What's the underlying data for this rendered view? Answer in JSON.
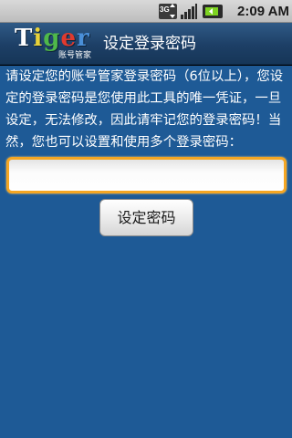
{
  "status_bar": {
    "network_label": "3G",
    "time": "2:09 AM",
    "icons": [
      "3g-data-icon",
      "signal-icon",
      "battery-icon"
    ]
  },
  "app_bar": {
    "logo_letters": [
      "T",
      "i",
      "g",
      "e",
      "r"
    ],
    "logo_colors": [
      "#ffffff",
      "#e8d23a",
      "#4fb84a",
      "#e03a2e",
      "#4a8fd8"
    ],
    "logo_subtitle": "账号管家",
    "title": "设定登录密码"
  },
  "main": {
    "instructions": "请设定您的账号管家登录密码（6位以上），您设定的登录密码是您使用此工具的唯一凭证，一旦设定，无法修改，因此请牢记您的登录密码！当然，您也可以设置和使用多个登录密码：",
    "password_input": {
      "value": "",
      "placeholder": ""
    },
    "set_button_label": "设定密码"
  },
  "colors": {
    "background": "#1e5a96",
    "title_bar": "#1d3f66",
    "input_focus_border": "#f5a623"
  }
}
